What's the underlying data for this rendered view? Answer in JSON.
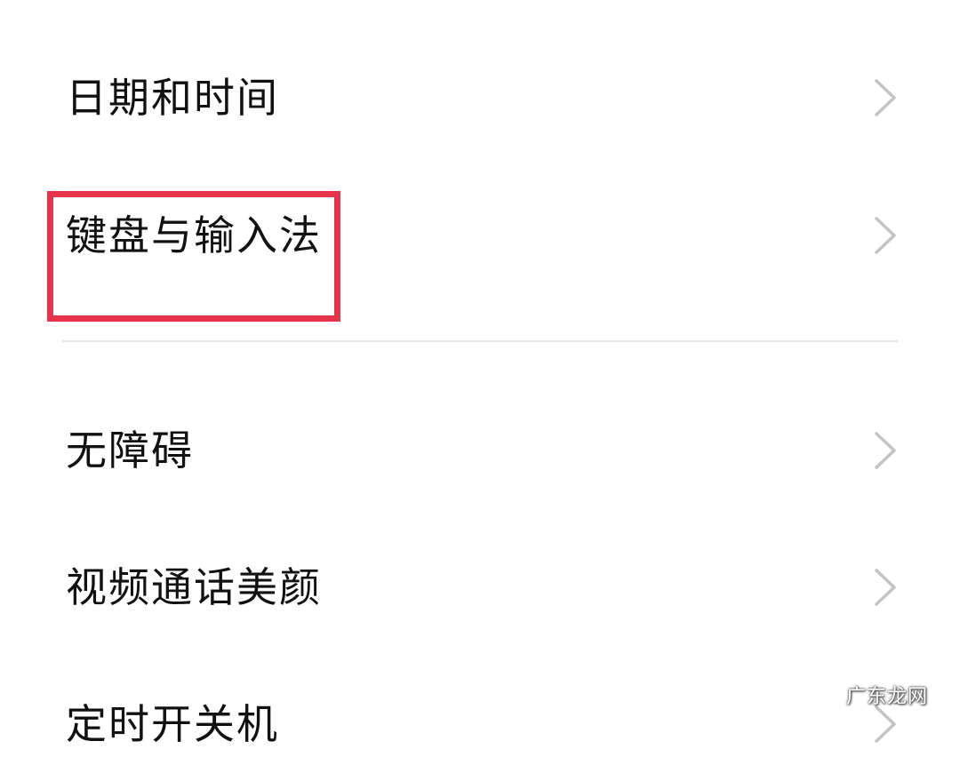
{
  "settings": {
    "items": [
      {
        "id": "datetime",
        "label": "日期和时间"
      },
      {
        "id": "keyboard",
        "label": "键盘与输入法"
      },
      {
        "id": "accessibility",
        "label": "无障碍"
      },
      {
        "id": "video-beauty",
        "label": "视频通话美颜"
      },
      {
        "id": "scheduled",
        "label": "定时开关机"
      }
    ]
  },
  "annotation": {
    "highlight_color": "#e8344a",
    "highlighted_item": "keyboard"
  },
  "watermark": {
    "text": "广东龙网"
  },
  "icons": {
    "chevron": "chevron-right-icon"
  }
}
